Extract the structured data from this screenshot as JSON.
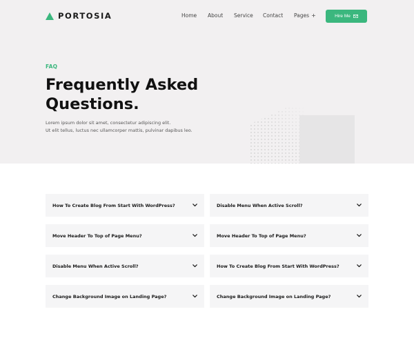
{
  "brand": {
    "name": "PORTOSIA",
    "accent": "#3bb77e"
  },
  "nav": {
    "items": [
      {
        "label": "Home"
      },
      {
        "label": "About"
      },
      {
        "label": "Service"
      },
      {
        "label": "Contact"
      },
      {
        "label": "Pages"
      }
    ],
    "pages_toggle": "+",
    "hire_label": "Hire Me",
    "hire_icon": "envelope-icon"
  },
  "hero": {
    "eyebrow": "FAQ",
    "title_line1": "Frequently Asked",
    "title_line2": "Questions.",
    "intro_line1": "Lorem ipsum dolor sit amet, consectetur adipiscing elit.",
    "intro_line2": "Ut elit tellus, luctus nec ullamcorper mattis, pulvinar dapibus leo."
  },
  "faq": {
    "left": [
      {
        "question": "How To Create Blog From Start With WordPress?"
      },
      {
        "question": "Move Header To Top of Page Menu?"
      },
      {
        "question": "Disable Menu When Active Scroll?"
      },
      {
        "question": "Change Background Image on Landing Page?"
      }
    ],
    "right": [
      {
        "question": "Disable Menu When Active Scroll?"
      },
      {
        "question": "Move Header To Top of Page Menu?"
      },
      {
        "question": "How To Create Blog From Start With WordPress?"
      },
      {
        "question": "Change Background Image on Landing Page?"
      }
    ],
    "expand_icon": "chevron-down-icon"
  }
}
